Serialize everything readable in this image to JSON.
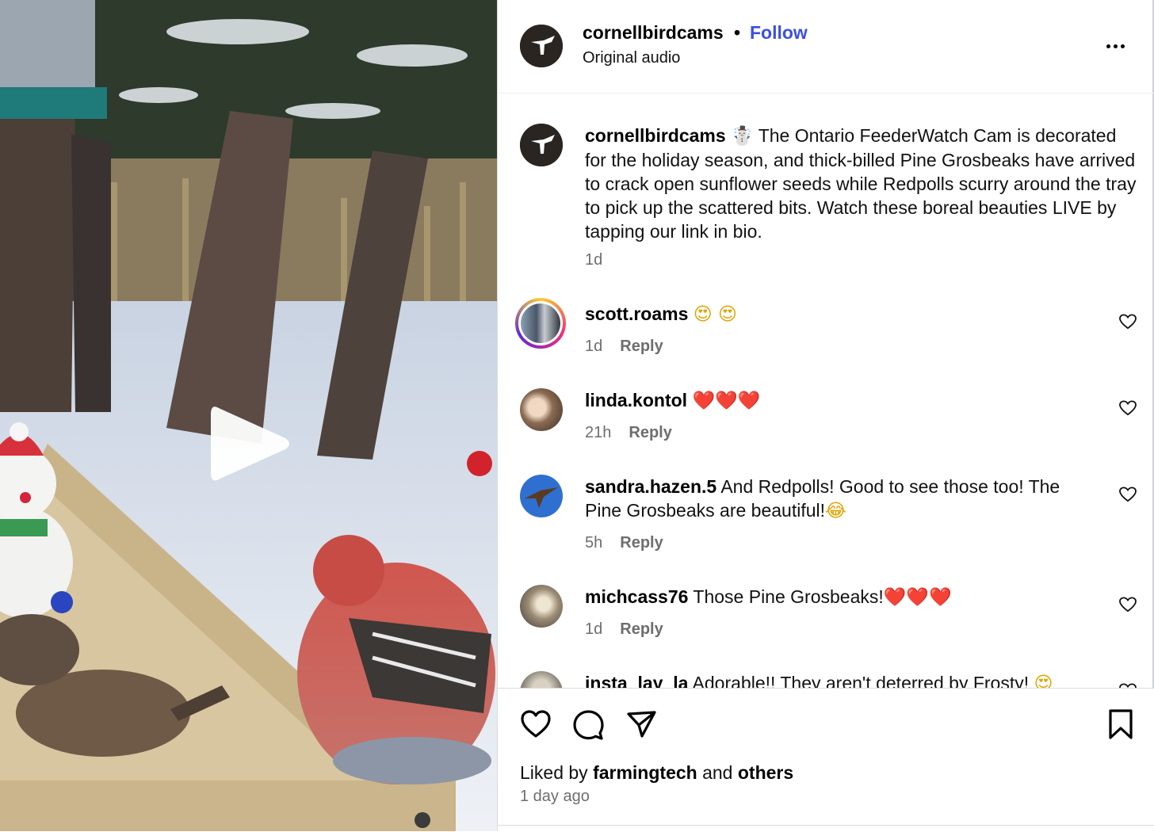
{
  "post": {
    "username": "cornellbirdcams",
    "separator": "•",
    "follow_label": "Follow",
    "audio_label": "Original audio",
    "avatar_icon": "hummingbird-logo-icon",
    "more_icon": "more-options-icon"
  },
  "caption": {
    "username": "cornellbirdcams",
    "emoji": "☃️",
    "text": "The Ontario FeederWatch Cam is decorated for the holiday season, and thick-billed Pine Grosbeaks have arrived to crack open sunflower seeds while Redpolls scurry around the tray to pick up the scattered bits. Watch these boreal beauties LIVE by tapping our link in bio.",
    "time": "1d"
  },
  "comments": [
    {
      "username": "scott.roams",
      "text": "",
      "emoji": "😍 😍",
      "time": "1d",
      "reply": "Reply"
    },
    {
      "username": "linda.kontol",
      "text": "",
      "emoji": "❤️❤️❤️",
      "time": "21h",
      "reply": "Reply"
    },
    {
      "username": "sandra.hazen.5",
      "text": "And Redpolls! Good to see those too! The Pine Grosbeaks are beautiful!",
      "emoji": "😂",
      "time": "5h",
      "reply": "Reply"
    },
    {
      "username": "michcass76",
      "text": "Those Pine Grosbeaks!",
      "emoji": "❤️❤️❤️",
      "time": "1d",
      "reply": "Reply"
    },
    {
      "username": "insta_lay_la",
      "text": "Adorable!! They aren't deterred by Frosty!",
      "emoji": "😍",
      "time": "",
      "reply": ""
    }
  ],
  "actions": {
    "like_icon": "heart-icon",
    "comment_icon": "comment-bubble-icon",
    "share_icon": "send-paper-plane-icon",
    "save_icon": "bookmark-icon"
  },
  "likes": {
    "prefix": "Liked by",
    "user": "farmingtech",
    "middle": "and",
    "others": "others"
  },
  "post_time": "1 day ago",
  "media": {
    "play_icon": "play-icon",
    "description_icon": "video-frame"
  }
}
